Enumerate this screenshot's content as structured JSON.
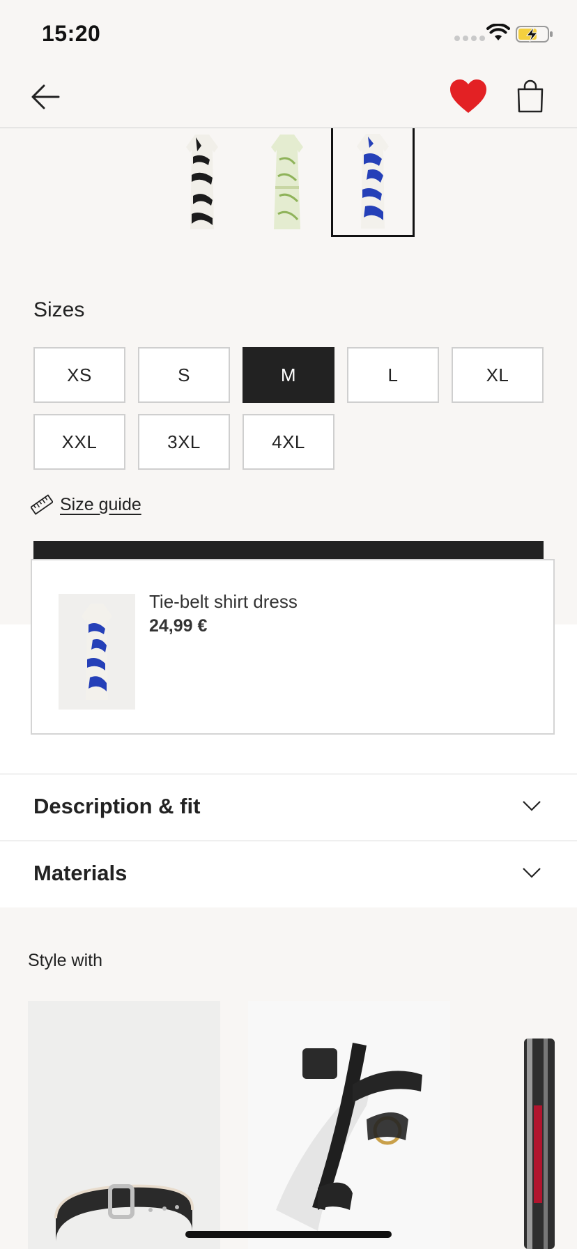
{
  "status_bar": {
    "time": "15:20"
  },
  "nav": {
    "back": "back",
    "favorite": "favorite",
    "bag": "shopping bag"
  },
  "colors": {
    "accent_red": "#e32124",
    "dark": "#222222"
  },
  "sizes": {
    "title": "Sizes",
    "options": [
      "XS",
      "S",
      "M",
      "L",
      "XL",
      "XXL",
      "3XL",
      "4XL"
    ],
    "selected": "M"
  },
  "size_guide": {
    "label": "Size guide"
  },
  "product": {
    "name": "Tie-belt shirt dress",
    "price": "24,99 €"
  },
  "accordions": [
    {
      "label": "Description & fit"
    },
    {
      "label": "Materials"
    }
  ],
  "style_with": {
    "title": "Style with"
  }
}
